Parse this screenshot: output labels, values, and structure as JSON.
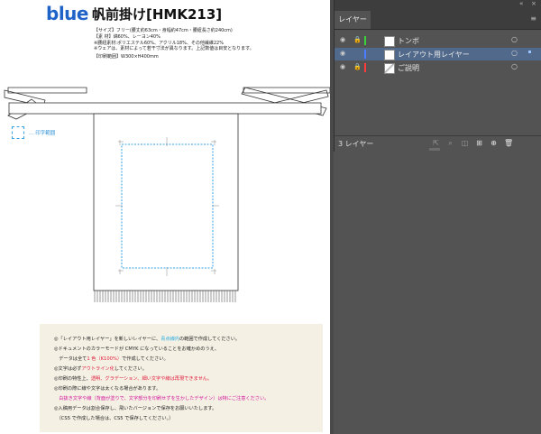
{
  "document": {
    "logo": "blue",
    "title": "帆前掛け[HMK213]",
    "spec_lines": [
      "【サイズ】フリー(腰丈約63cm・身幅約47cm・腰紐長さ約240cm)",
      "【素 材】綿60%、レーヨン40%",
      "※腰紐素材:ポリエステル60%、アクリル18%、その他繊維22%",
      "※ウェアは、素材によって若干寸法が異なります。上記数値は目安となります。",
      "【印刷範囲】W300×H400mm"
    ],
    "legend_label": "… 印字範囲",
    "notes": [
      {
        "parts": [
          {
            "t": "◎「レイアウト用レイヤー」を新しいレイヤーに、",
            "c": ""
          },
          {
            "t": "青点線内",
            "c": "cyan"
          },
          {
            "t": "の範囲で作成してください。",
            "c": ""
          }
        ]
      },
      {
        "parts": [
          {
            "t": "◎ドキュメントのカラーモードが CMYK になっていることをお確かめのうえ、",
            "c": ""
          }
        ]
      },
      {
        "parts": [
          {
            "t": "　データは全て",
            "c": ""
          },
          {
            "t": "1 色（K100%）",
            "c": "red"
          },
          {
            "t": "で作成してください。",
            "c": ""
          }
        ]
      },
      {
        "parts": [
          {
            "t": "◎文字は必ず",
            "c": ""
          },
          {
            "t": "アウトライン化",
            "c": "red"
          },
          {
            "t": "してください。",
            "c": ""
          }
        ]
      },
      {
        "parts": [
          {
            "t": "◎印刷の特性上、",
            "c": ""
          },
          {
            "t": "透明、グラデーション、細い文字や線は再現できません。",
            "c": "red"
          }
        ]
      },
      {
        "parts": [
          {
            "t": "◎印刷の際に線や文字は太くなる場合があります。",
            "c": ""
          }
        ]
      },
      {
        "parts": [
          {
            "t": "　白抜き文字や線（背面が塗りで、文字部分を印刷せずを生かしたデザイン）は特にご注意ください。",
            "c": "mag"
          }
        ]
      },
      {
        "parts": [
          {
            "t": "◎入稿用データは割合保存し、飛いたバージョンで保存をお願いいたします。",
            "c": ""
          }
        ]
      },
      {
        "parts": [
          {
            "t": "　（CS5 で作成した場合は、CS5 で保存してください。）",
            "c": ""
          }
        ]
      }
    ]
  },
  "layers_panel": {
    "tab_label": "レイヤー",
    "collapse_icon": "double-chevron",
    "close_icon": "close-x",
    "menu_icon": "hamburger",
    "layers": [
      {
        "name": "トンボ",
        "visible": true,
        "locked": true,
        "color": "#3bd13b",
        "selected": false,
        "thumb": "white"
      },
      {
        "name": "レイアウト用レイヤー",
        "visible": true,
        "locked": false,
        "color": "#4a7dff",
        "selected": true,
        "thumb": "white"
      },
      {
        "name": "ご説明",
        "visible": true,
        "locked": true,
        "color": "#ff3b3b",
        "selected": false,
        "thumb": "mixed"
      }
    ],
    "layer_count": "3 レイヤー",
    "footer_icons": [
      "collect-export-icon",
      "locate-object-icon",
      "make-clipping-mask-icon",
      "create-sublayer-icon",
      "new-layer-icon",
      "delete-layer-icon"
    ]
  }
}
